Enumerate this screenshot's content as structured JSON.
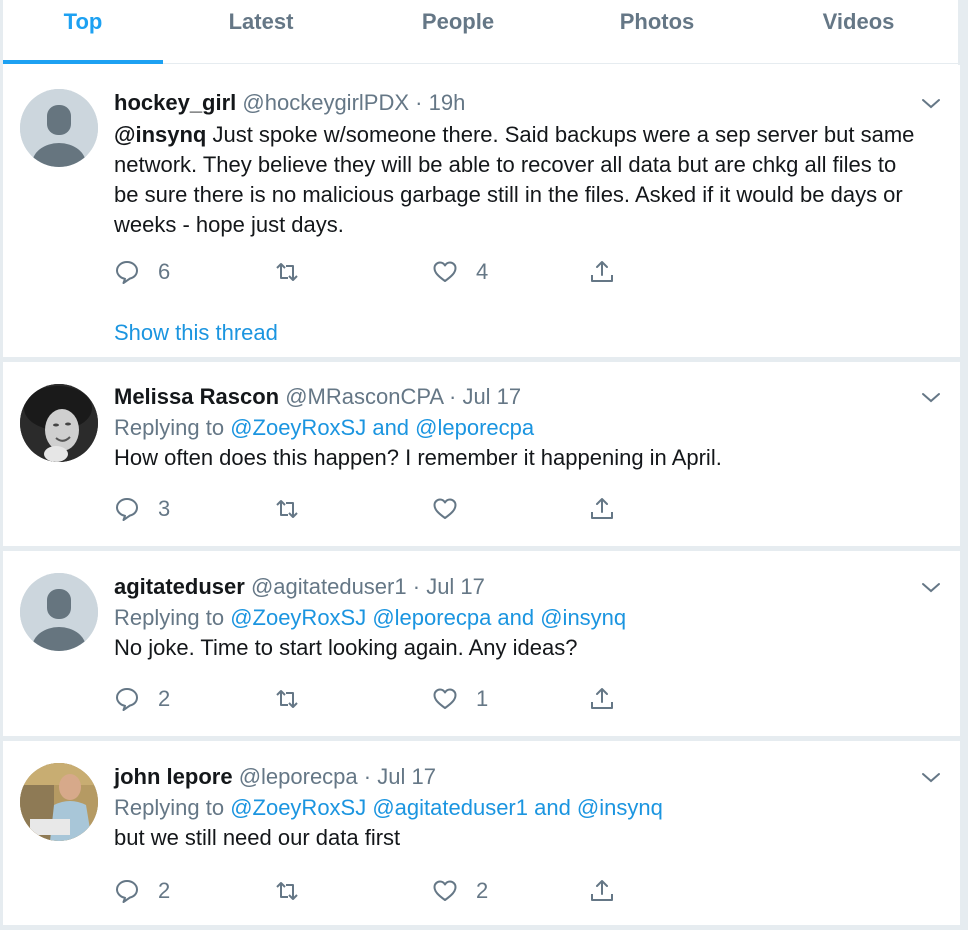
{
  "tabs": [
    {
      "label": "Top",
      "active": true
    },
    {
      "label": "Latest",
      "active": false
    },
    {
      "label": "People",
      "active": false
    },
    {
      "label": "Photos",
      "active": false
    },
    {
      "label": "Videos",
      "active": false
    }
  ],
  "colors": {
    "accent": "#1da1f2",
    "link": "#1b95e0",
    "muted": "#657786",
    "text": "#14171a",
    "divider": "#e6ecf0"
  },
  "tweets": [
    {
      "name": "hockey_girl",
      "handle": "@hockeygirlPDX",
      "separator": "·",
      "time": "19h",
      "avatar": "default-avatar",
      "body_mention": "@insynq",
      "body": " Just spoke w/someone there. Said backups were a sep server but same network. They believe they will be able to recover all data but are chkg all files to be sure there is no malicious garbage still in the files. Asked if it would be days or weeks - hope just days.",
      "replies": "6",
      "retweets": "",
      "likes": "4",
      "show_thread": "Show this thread"
    },
    {
      "name": "Melissa Rascon",
      "handle": "@MRasconCPA",
      "separator": "·",
      "time": "Jul 17",
      "avatar": "photo-avatar",
      "replying_prefix": "Replying to ",
      "replying_to": "@ZoeyRoxSJ and @leporecpa",
      "body": "How often does this happen?  I remember it happening in April.",
      "replies": "3",
      "retweets": "",
      "likes": ""
    },
    {
      "name": "agitateduser",
      "handle": "@agitateduser1",
      "separator": "·",
      "time": "Jul 17",
      "avatar": "default-avatar",
      "replying_prefix": "Replying to ",
      "replying_to": "@ZoeyRoxSJ @leporecpa and @insynq",
      "body": "No joke.  Time to start looking again.  Any ideas?",
      "replies": "2",
      "retweets": "",
      "likes": "1"
    },
    {
      "name": "john lepore",
      "handle": "@leporecpa",
      "separator": "·",
      "time": "Jul 17",
      "avatar": "photo-avatar",
      "replying_prefix": "Replying to ",
      "replying_to": "@ZoeyRoxSJ @agitateduser1 and @insynq",
      "body": "but we still need our data first",
      "replies": "2",
      "retweets": "",
      "likes": "2"
    }
  ]
}
